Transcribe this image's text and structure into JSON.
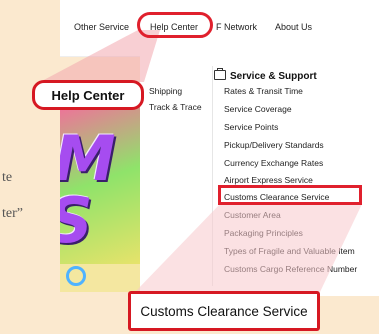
{
  "background": {
    "text_fragments": [
      "te",
      "ter”"
    ]
  },
  "topnav": {
    "items": [
      "Other Service",
      "Help Center",
      "F Network",
      "About Us"
    ]
  },
  "menu": {
    "left_items": [
      "Shipping",
      "Track & Trace"
    ],
    "section_title": "Service & Support",
    "section_items": [
      "Rates & Transit Time",
      "Service Coverage",
      "Service Points",
      "Pickup/Delivery Standards",
      "Currency Exchange Rates",
      "Airport Express Service",
      "Customs Clearance Service",
      "Customer Area",
      "Packaging Principles",
      "Types of Fragile and Valuable Item",
      "Customs Cargo Reference Number"
    ]
  },
  "callouts": {
    "help_center": "Help Center",
    "customs": "Customs Clearance Service"
  },
  "colors": {
    "highlight": "#e0202d",
    "callout_fill": "#f7d3d6",
    "page_bg": "#fbe9cf"
  }
}
